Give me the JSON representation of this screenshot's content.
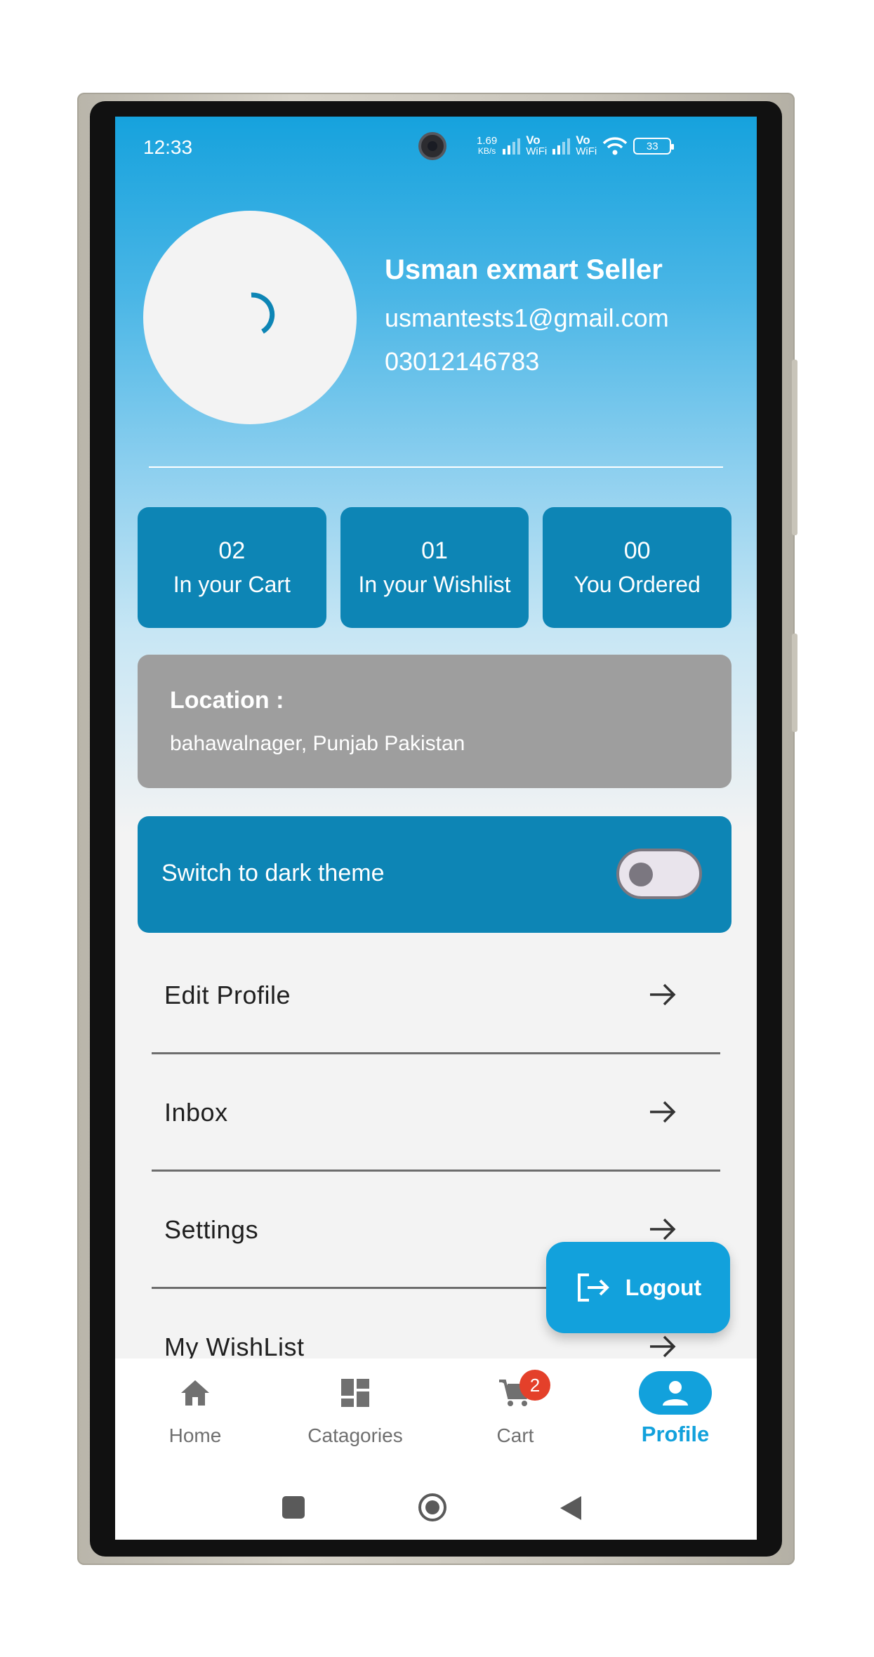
{
  "status_bar": {
    "time": "12:33",
    "net_speed_value": "1.69",
    "net_speed_unit": "KB/s",
    "sim1_label_top": "Vo",
    "sim1_label_bottom": "WiFi",
    "sim2_label_top": "Vo",
    "sim2_label_bottom": "WiFi",
    "battery_level": "33",
    "icons": [
      "signal-icon",
      "wifi-icon",
      "battery-icon"
    ]
  },
  "profile": {
    "name": "Usman exmart Seller",
    "email": "usmantests1@gmail.com",
    "phone": "03012146783",
    "avatar_state": "loading"
  },
  "stats": [
    {
      "count": "02",
      "label": "In your Cart"
    },
    {
      "count": "01",
      "label": "In your Wishlist"
    },
    {
      "count": "00",
      "label": "You Ordered"
    }
  ],
  "location": {
    "title": "Location :",
    "value": "bahawalnager, Punjab Pakistan"
  },
  "theme_switch": {
    "label": "Switch to dark theme",
    "enabled": false
  },
  "menu": [
    {
      "label": "Edit Profile",
      "icon": "arrow-right-icon"
    },
    {
      "label": "Inbox",
      "icon": "arrow-right-icon"
    },
    {
      "label": "Settings",
      "icon": "arrow-right-icon"
    },
    {
      "label": "My WishList",
      "icon": "arrow-right-icon"
    }
  ],
  "logout": {
    "label": "Logout",
    "icon": "logout-icon"
  },
  "bottom_nav": {
    "items": [
      {
        "label": "Home",
        "icon": "home-icon"
      },
      {
        "label": "Catagories",
        "icon": "dashboard-icon"
      },
      {
        "label": "Cart",
        "icon": "cart-icon",
        "badge": "2"
      },
      {
        "label": "Profile",
        "icon": "person-icon",
        "active": true
      }
    ]
  },
  "colors": {
    "primary": "#12a1dc",
    "card": "#0d85b5",
    "location_card": "#9e9e9e",
    "badge": "#e4402a"
  }
}
